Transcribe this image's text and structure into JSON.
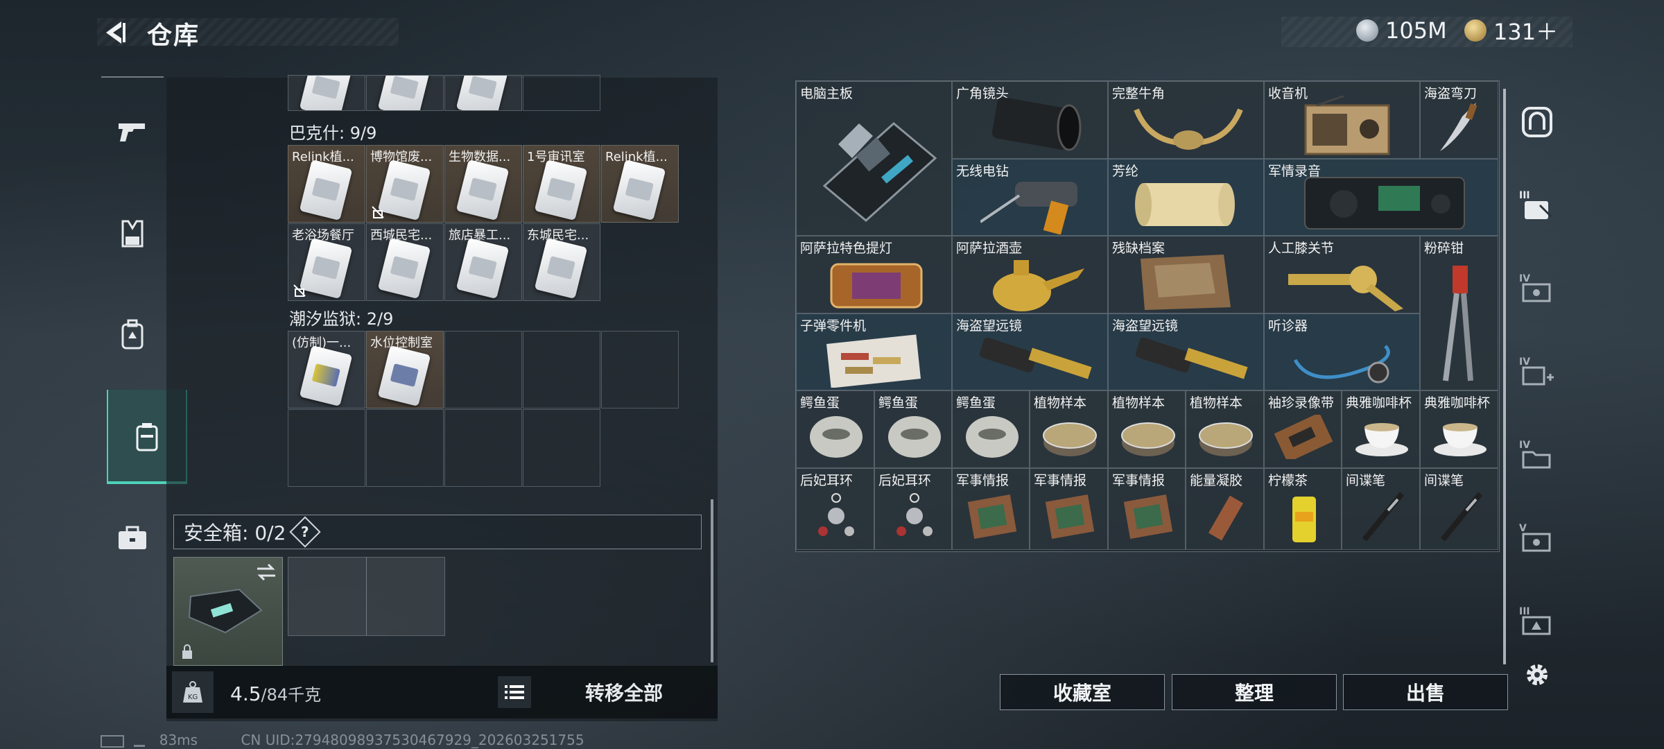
{
  "header": {
    "title": "仓库"
  },
  "currency": [
    {
      "amount": "105M",
      "icon": "silver-coin-icon",
      "color": "#b9c3cc"
    },
    {
      "amount": "131＋",
      "icon": "gold-coin-icon",
      "color": "#c9a55a"
    }
  ],
  "left_nav": [
    "weapon-tab-icon",
    "armor-tab-icon",
    "backpack-tab-icon",
    "container-tab-icon",
    "toolbox-tab-icon"
  ],
  "collections": {
    "bakshi": {
      "label": "巴克什: 9/9",
      "items": [
        "Relink植...",
        "博物馆废...",
        "生物数据...",
        "1号审讯室",
        "Relink植...",
        "老浴场餐厅",
        "西城民宅...",
        "旅店暴工...",
        "东城民宅..."
      ]
    },
    "tide_prison": {
      "label": "潮汐监狱: 2/9",
      "items": [
        "(仿制)一...",
        "水位控制室"
      ]
    }
  },
  "safebox": {
    "label": "安全箱: 0/2",
    "help": "?"
  },
  "weight": {
    "current": "4.5",
    "max": "/84千克"
  },
  "actions": {
    "transfer_all": "转移全部"
  },
  "footer": {
    "ping": "83ms",
    "uid": "CN UID:27948098937530467929_202603251755"
  },
  "stash_items": [
    "电脑主板",
    "广角镜头",
    "完整牛角",
    "收音机",
    "海盗弯刀",
    "无线电钻",
    "芳纶",
    "军情录音",
    "阿萨拉特色提灯",
    "阿萨拉酒壶",
    "残缺档案",
    "人工膝关节",
    "粉碎钳",
    "子弹零件机",
    "海盗望远镜",
    "海盗望远镜",
    "听诊器",
    "鳄鱼蛋",
    "鳄鱼蛋",
    "鳄鱼蛋",
    "植物样本",
    "植物样本",
    "植物样本",
    "袖珍录像带",
    "典雅咖啡杯",
    "典雅咖啡杯",
    "后妃耳环",
    "后妃耳环",
    "军事情报",
    "军事情报",
    "军事情报",
    "能量凝胶",
    "柠檬茶",
    "间谍笔",
    "间谍笔"
  ],
  "buttons": {
    "collection_room": "收藏室",
    "organize": "整理",
    "sell": "出售"
  }
}
